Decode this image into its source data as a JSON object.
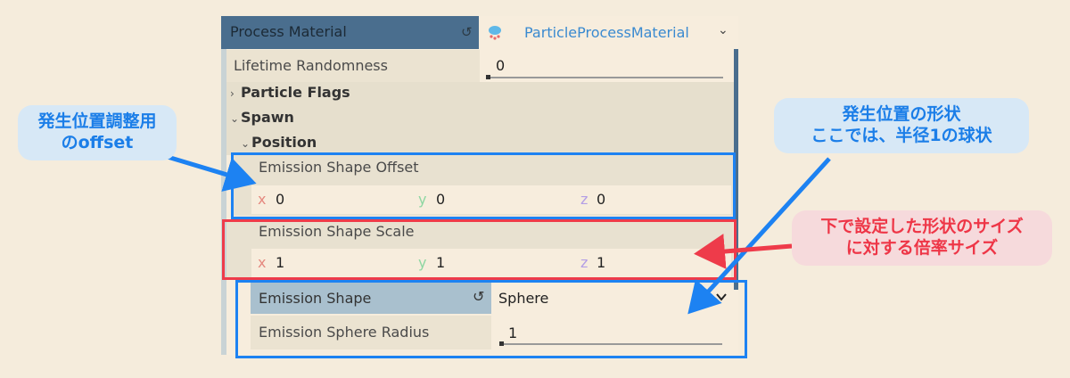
{
  "header": {
    "title": "Process Material",
    "resource_name": "ParticleProcessMaterial"
  },
  "rows": {
    "lifetime_randomness": {
      "label": "Lifetime Randomness",
      "value": "0"
    },
    "particle_flags": "Particle Flags",
    "spawn": "Spawn",
    "position": "Position",
    "offset": {
      "label": "Emission Shape Offset",
      "x": "0",
      "y": "0",
      "z": "0"
    },
    "scale": {
      "label": "Emission Shape Scale",
      "x": "1",
      "y": "1",
      "z": "1"
    },
    "shape": {
      "label": "Emission Shape",
      "value": "Sphere"
    },
    "radius": {
      "label": "Emission Sphere Radius",
      "value": "1"
    }
  },
  "axes": {
    "x": "x",
    "y": "y",
    "z": "z"
  },
  "annotations": {
    "offset_note": {
      "line1": "発生位置調整用",
      "line2": "のoffset"
    },
    "shape_note": {
      "line1": "発生位置の形状",
      "line2": "ここでは、半径1の球状"
    },
    "scale_note": {
      "line1": "下で設定した形状のサイズ",
      "line2": "に対する倍率サイズ"
    }
  },
  "colors": {
    "accent_blue": "#1d82f2",
    "accent_red": "#ee3b4a",
    "header_bg": "#4a6e8e",
    "resource_text": "#3a8ad0"
  },
  "icons": [
    "reset-icon",
    "particle-icon",
    "chevron-down-icon",
    "expand-arrow-icon",
    "collapse-arrow-icon"
  ]
}
